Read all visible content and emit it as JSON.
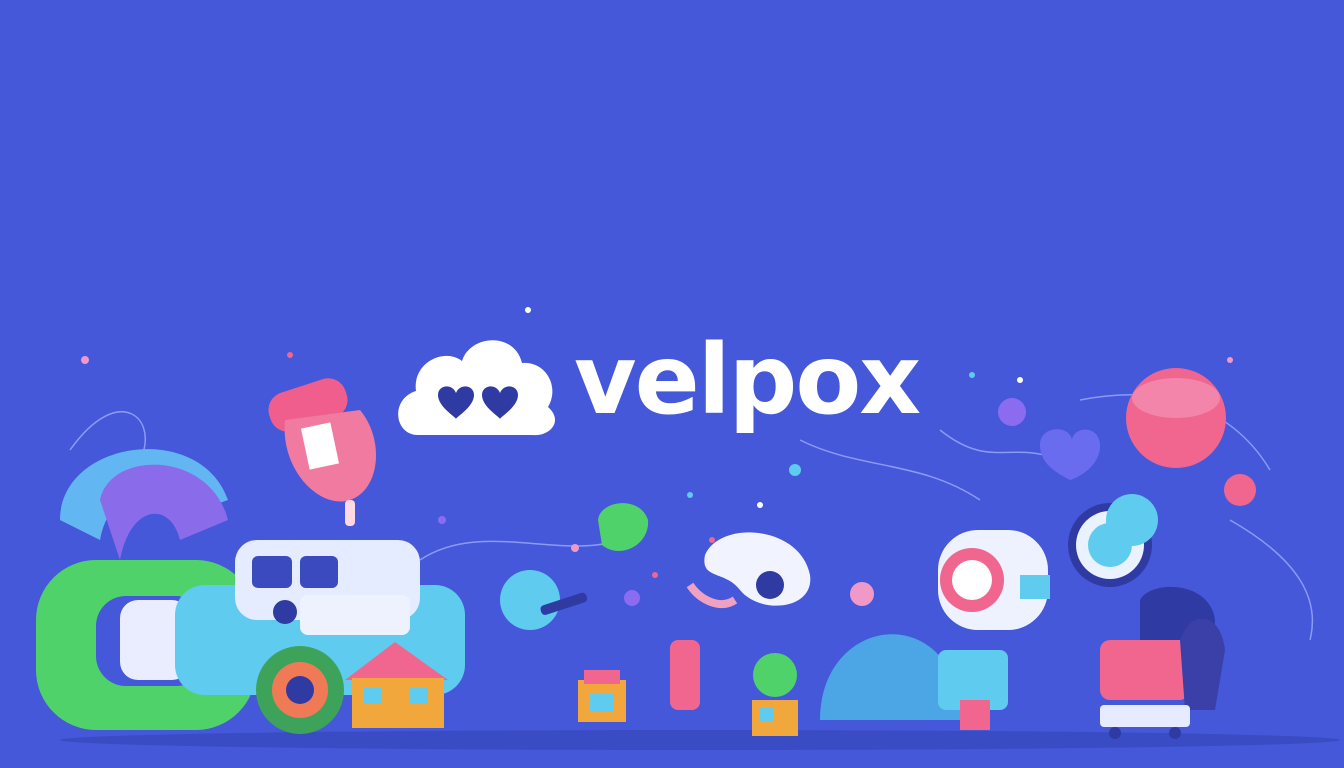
{
  "brand": {
    "name": "velpox",
    "logo_icon": "cloud-with-hearts-icon"
  },
  "colors": {
    "background": "#4458d9",
    "logo_white": "#ffffff",
    "heart_navy": "#2f3aa3",
    "accent_pink": "#f0668e",
    "accent_green": "#4fd26a",
    "accent_cyan": "#5fd0f0",
    "accent_purple": "#8b6cf0"
  },
  "illustration": {
    "left_group": [
      "truck",
      "green-ring",
      "mushroom-dome",
      "house",
      "mitten"
    ],
    "center_group": [
      "balloon",
      "leaf-blob",
      "swirl-ribbon",
      "tree",
      "shop"
    ],
    "right_group": [
      "pink-planet",
      "robot-camera",
      "creatures",
      "dome",
      "cart"
    ]
  }
}
